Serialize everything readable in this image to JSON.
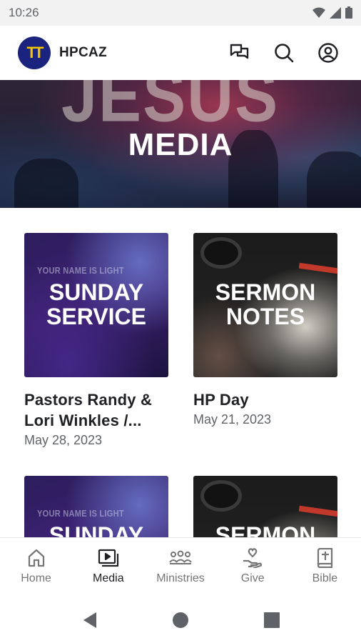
{
  "status_bar": {
    "time": "10:26"
  },
  "app_bar": {
    "title": "HPCAZ",
    "logo_text": "TT",
    "actions": [
      "chat-icon",
      "search-icon",
      "account-icon"
    ]
  },
  "hero": {
    "background_word": "JESUS",
    "title": "MEDIA"
  },
  "cards": [
    {
      "thumb_small": "YOUR NAME IS LIGHT",
      "thumb_lines": [
        "SUNDAY",
        "SERVICE"
      ],
      "title": "Pastors Randy & Lori Winkles /...",
      "date": "May 28, 2023"
    },
    {
      "thumb_small": "",
      "thumb_lines": [
        "SERMON",
        "NOTES"
      ],
      "title": "HP Day",
      "date": "May 21, 2023"
    },
    {
      "thumb_small": "YOUR NAME IS LIGHT",
      "thumb_lines": [
        "SUNDAY"
      ]
    },
    {
      "thumb_small": "",
      "thumb_lines": [
        "SERMON"
      ]
    }
  ],
  "bottom_nav": [
    {
      "label": "Home",
      "icon": "home-icon",
      "active": false
    },
    {
      "label": "Media",
      "icon": "media-icon",
      "active": true
    },
    {
      "label": "Ministries",
      "icon": "ministries-icon",
      "active": false
    },
    {
      "label": "Give",
      "icon": "give-icon",
      "active": false
    },
    {
      "label": "Bible",
      "icon": "bible-icon",
      "active": false
    }
  ],
  "colors": {
    "logo_bg": "#1a237e",
    "logo_fg": "#f5c400",
    "text": "#202124",
    "muted": "#5f6368"
  }
}
